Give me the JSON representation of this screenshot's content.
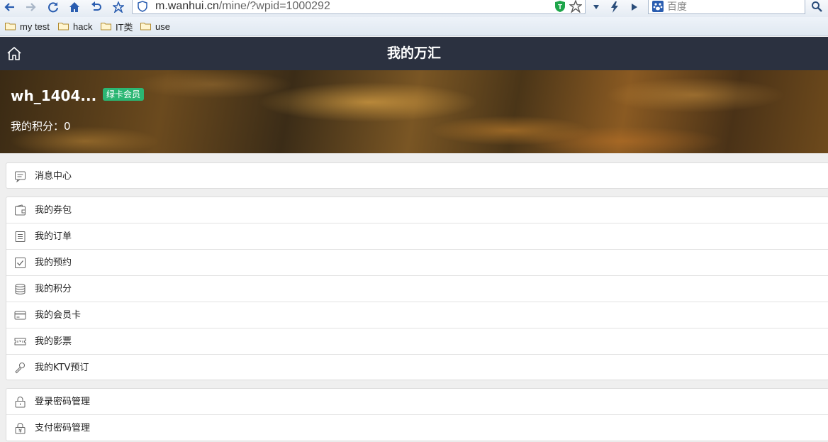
{
  "browser": {
    "url_host": "m.wanhui.cn",
    "url_path": "/mine/?wpid=1000292",
    "search_placeholder": "百度",
    "bookmarks": [
      {
        "label": "my test"
      },
      {
        "label": "hack"
      },
      {
        "label": "IT类"
      },
      {
        "label": "use"
      }
    ]
  },
  "header": {
    "title": "我的万汇"
  },
  "profile": {
    "username": "wh_1404...",
    "badge": "绿卡会员",
    "points": "我的积分：0"
  },
  "menu": {
    "messages": {
      "label": "消息中心",
      "icon": "message-icon"
    },
    "coupons": {
      "label": "我的券包",
      "icon": "wallet-icon"
    },
    "orders": {
      "label": "我的订单",
      "icon": "order-list-icon"
    },
    "reservations": {
      "label": "我的预约",
      "icon": "checkbox-icon"
    },
    "points": {
      "label": "我的积分",
      "icon": "coins-icon"
    },
    "member_card": {
      "label": "我的会员卡",
      "icon": "card-icon"
    },
    "movie_tickets": {
      "label": "我的影票",
      "icon": "ticket-icon"
    },
    "ktv": {
      "label": "我的KTV预订",
      "icon": "microphone-icon"
    },
    "login_password": {
      "label": "登录密码管理",
      "icon": "lock-icon"
    },
    "pay_password": {
      "label": "支付密码管理",
      "icon": "yen-lock-icon"
    }
  },
  "colors": {
    "header_bg": "#2b3140",
    "badge_bg": "#2bb673"
  }
}
